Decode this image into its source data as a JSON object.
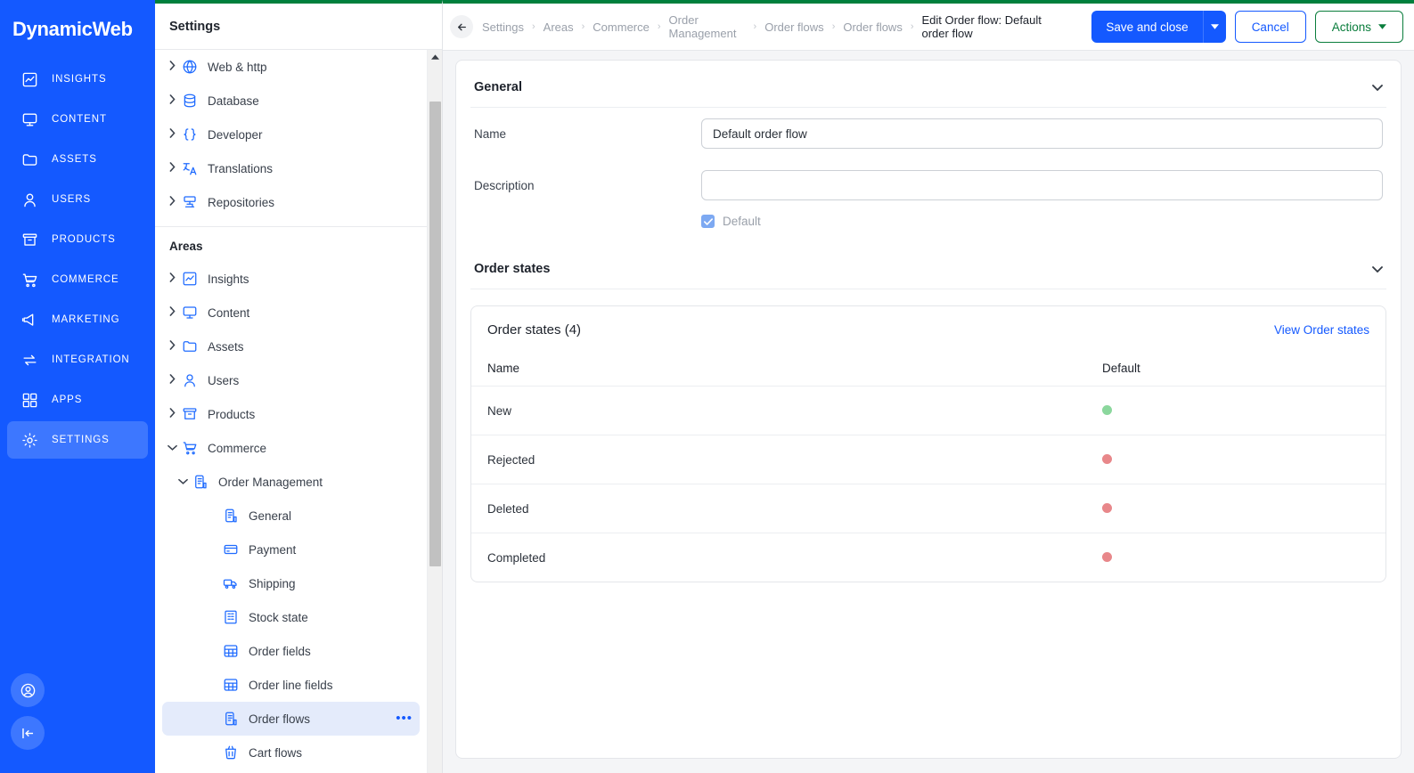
{
  "brand": "DynamicWeb",
  "theme": {
    "nav_blue": "#1459ff",
    "nav_active": "#3d77ff",
    "accent_green": "#00803d",
    "link_blue": "#1459ff"
  },
  "mainnav": {
    "items": [
      {
        "label": "INSIGHTS",
        "icon": "chart-line-icon",
        "active": false
      },
      {
        "label": "CONTENT",
        "icon": "monitor-icon",
        "active": false
      },
      {
        "label": "ASSETS",
        "icon": "folder-icon",
        "active": false
      },
      {
        "label": "USERS",
        "icon": "user-icon",
        "active": false
      },
      {
        "label": "PRODUCTS",
        "icon": "box-icon",
        "active": false
      },
      {
        "label": "COMMERCE",
        "icon": "cart-icon",
        "active": false
      },
      {
        "label": "MARKETING",
        "icon": "megaphone-icon",
        "active": false
      },
      {
        "label": "INTEGRATION",
        "icon": "arrows-swap-icon",
        "active": false
      },
      {
        "label": "APPS",
        "icon": "grid-icon",
        "active": false
      },
      {
        "label": "SETTINGS",
        "icon": "gear-icon",
        "active": true
      }
    ],
    "bottom": [
      {
        "icon": "account-circle-icon"
      },
      {
        "icon": "collapse-panel-icon"
      }
    ]
  },
  "tree": {
    "title": "Settings",
    "top_items": [
      {
        "label": "Web & http",
        "icon": "globe-icon",
        "caret": "›"
      },
      {
        "label": "Database",
        "icon": "database-icon",
        "caret": "›"
      },
      {
        "label": "Developer",
        "icon": "braces-icon",
        "caret": "›"
      },
      {
        "label": "Translations",
        "icon": "translate-icon",
        "caret": "›"
      },
      {
        "label": "Repositories",
        "icon": "repository-icon",
        "caret": "›"
      }
    ],
    "group_label": "Areas",
    "area_items": [
      {
        "label": "Insights",
        "icon": "chart-line-icon",
        "caret": "›",
        "depth": 0
      },
      {
        "label": "Content",
        "icon": "monitor-icon",
        "caret": "›",
        "depth": 0
      },
      {
        "label": "Assets",
        "icon": "folder-icon",
        "caret": "›",
        "depth": 0
      },
      {
        "label": "Users",
        "icon": "user-icon",
        "caret": "›",
        "depth": 0
      },
      {
        "label": "Products",
        "icon": "box-icon",
        "caret": "›",
        "depth": 0
      },
      {
        "label": "Commerce",
        "icon": "cart-icon",
        "caret": "⌄",
        "depth": 0,
        "expanded": true
      },
      {
        "label": "Order Management",
        "icon": "clipboard-icon",
        "caret": "⌄",
        "depth": 1,
        "expanded": true
      },
      {
        "label": "General",
        "icon": "clipboard-icon",
        "caret": "",
        "depth": 2
      },
      {
        "label": "Payment",
        "icon": "card-icon",
        "caret": "",
        "depth": 2
      },
      {
        "label": "Shipping",
        "icon": "truck-icon",
        "caret": "",
        "depth": 2
      },
      {
        "label": "Stock state",
        "icon": "building-icon",
        "caret": "",
        "depth": 2
      },
      {
        "label": "Order fields",
        "icon": "table-icon",
        "caret": "",
        "depth": 2
      },
      {
        "label": "Order line fields",
        "icon": "table-icon",
        "caret": "",
        "depth": 2
      },
      {
        "label": "Order flows",
        "icon": "clipboard-icon",
        "caret": "",
        "depth": 2,
        "selected": true,
        "menu": "•••"
      },
      {
        "label": "Cart flows",
        "icon": "basket-icon",
        "caret": "",
        "depth": 2
      }
    ]
  },
  "topbar": {
    "back_icon": "arrow-left-icon",
    "breadcrumbs": [
      {
        "label": "Settings"
      },
      {
        "label": "Areas"
      },
      {
        "label": "Commerce"
      },
      {
        "label": "Order Management"
      },
      {
        "label": "Order flows"
      },
      {
        "label": "Order flows"
      },
      {
        "label": "Edit Order flow: Default order flow",
        "current": true
      }
    ],
    "separator": "›",
    "save_label": "Save and close",
    "cancel_label": "Cancel",
    "actions_label": "Actions"
  },
  "general": {
    "section_label": "General",
    "name_label": "Name",
    "name_value": "Default order flow",
    "description_label": "Description",
    "description_value": "",
    "default_label": "Default",
    "default_checked": true,
    "check_glyph": "✓"
  },
  "order_states": {
    "section_label": "Order states",
    "card_title": "Order states (4)",
    "view_link": "View Order states",
    "columns": [
      "Name",
      "Default"
    ],
    "rows": [
      {
        "name": "New",
        "default": true,
        "dot_color": "#8bd79d"
      },
      {
        "name": "Rejected",
        "default": false,
        "dot_color": "#e8878a"
      },
      {
        "name": "Deleted",
        "default": false,
        "dot_color": "#e8878a"
      },
      {
        "name": "Completed",
        "default": false,
        "dot_color": "#e8878a"
      }
    ]
  }
}
